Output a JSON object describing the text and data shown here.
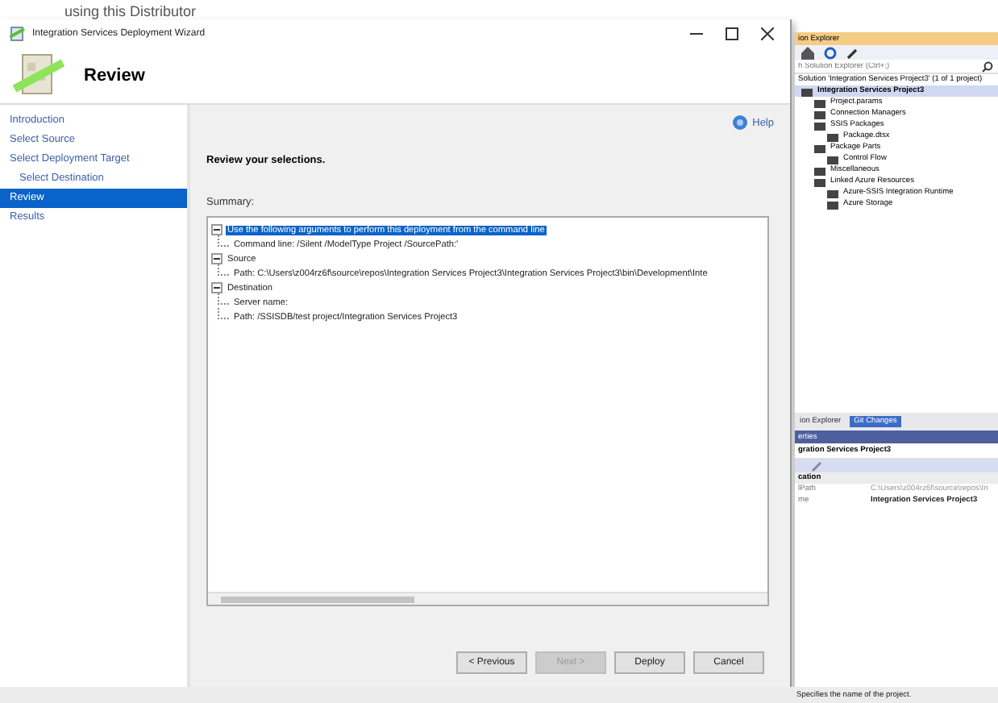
{
  "background_text": "using this Distributor",
  "wizard": {
    "title": "Integration Services Deployment Wizard",
    "heading": "Review",
    "steps": [
      {
        "label": "Introduction",
        "selected": false
      },
      {
        "label": "Select Source",
        "selected": false
      },
      {
        "label": "Select Deployment Target",
        "selected": false,
        "children": [
          {
            "label": "Select Destination",
            "selected": false
          }
        ]
      },
      {
        "label": "Review",
        "selected": true
      },
      {
        "label": "Results",
        "selected": false
      }
    ],
    "help": "Help",
    "instruction": "Review your selections.",
    "summary_label": "Summary:",
    "summary_tree": [
      {
        "label": "Use the following arguments to perform this deployment from the command line",
        "selected": true,
        "expanded": true,
        "children": [
          {
            "label": "Command line: /Silent /ModelType Project /SourcePath:'"
          }
        ]
      },
      {
        "label": "Source",
        "selected": false,
        "expanded": true,
        "children": [
          {
            "label": "Path: C:\\Users\\z004rz6f\\source\\repos\\Integration Services Project3\\Integration Services Project3\\bin\\Development\\Inte"
          }
        ]
      },
      {
        "label": "Destination",
        "selected": false,
        "expanded": true,
        "children": [
          {
            "label": "Server name:"
          },
          {
            "label": "Path: /SSISDB/test project/Integration Services Project3"
          }
        ]
      }
    ],
    "buttons": [
      {
        "label": "< Previous",
        "disabled": false
      },
      {
        "label": "Next >",
        "disabled": true
      },
      {
        "label": "Deploy",
        "disabled": false
      },
      {
        "label": "Cancel",
        "disabled": false
      }
    ]
  },
  "solution_explorer": {
    "title": "ion Explorer",
    "search": {
      "placeholder": "h Solution Explorer (Ctrl+;)"
    },
    "solution": "Solution 'Integration Services Project3' (1 of 1 project)",
    "tree": [
      {
        "label": "Integration Services Project3",
        "selected": true,
        "children": [
          {
            "label": "Project.params"
          },
          {
            "label": "Connection Managers"
          },
          {
            "label": "SSIS Packages",
            "children": [
              {
                "label": "Package.dtsx"
              }
            ]
          },
          {
            "label": "Package Parts",
            "children": [
              {
                "label": "Control Flow"
              }
            ]
          },
          {
            "label": "Miscellaneous"
          },
          {
            "label": "Linked Azure Resources",
            "children": [
              {
                "label": "Azure-SSIS Integration Runtime"
              },
              {
                "label": "Azure Storage"
              }
            ]
          }
        ]
      }
    ],
    "tabs": [
      {
        "label": "ion Explorer",
        "selected": false
      },
      {
        "label": "Git Changes",
        "selected": true
      }
    ]
  },
  "properties": {
    "title": "erties",
    "object": "gration Services Project3",
    "category": "cation",
    "rows": [
      {
        "name": "lPath",
        "value": "C:\\Users\\z004rz6f\\source\\repos\\In",
        "bold": false
      },
      {
        "name": "me",
        "value": "Integration Services Project3",
        "bold": true
      }
    ],
    "description": "Specifies the name of the project."
  }
}
